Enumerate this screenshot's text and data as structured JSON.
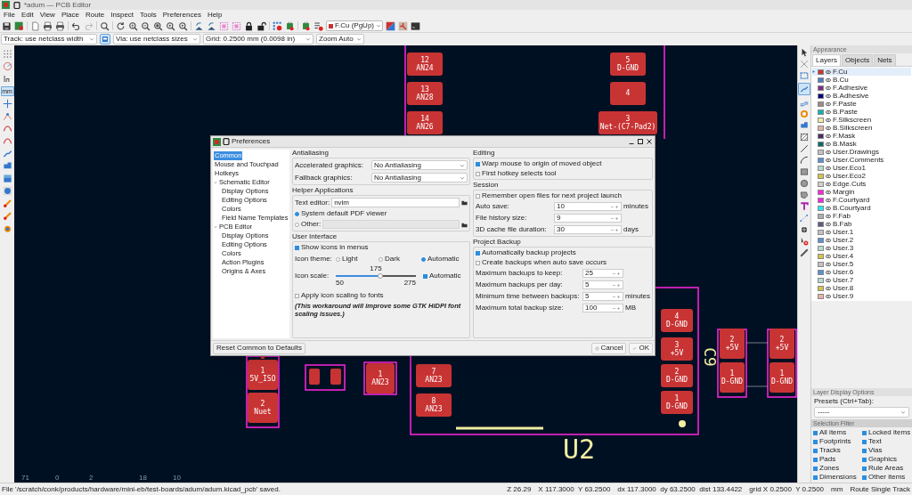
{
  "window": {
    "title": "*adum — PCB Editor"
  },
  "menu": [
    "File",
    "Edit",
    "View",
    "Place",
    "Route",
    "Inspect",
    "Tools",
    "Preferences",
    "Help"
  ],
  "toolbar": {
    "layer_select": "F.Cu (PgUp)"
  },
  "options_bar": {
    "track": "Track: use netclass width",
    "auto_width_on": true,
    "via": "Via: use netclass sizes",
    "grid": "Grid: 0.2500 mm (0.0098 in)",
    "zoom": "Zoom Auto"
  },
  "left_toolbar": {
    "units": "mm"
  },
  "canvas": {
    "pads": [
      {
        "number": "12",
        "net": "AN24"
      },
      {
        "number": "13",
        "net": "AN28"
      },
      {
        "number": "14",
        "net": "AN26"
      },
      {
        "number": "5",
        "net": "D-GND"
      },
      {
        "number": "4"
      },
      {
        "number": "3",
        "net": "Net-(C7-Pad2)"
      },
      {
        "number": "1",
        "net": "5V_ISO"
      },
      {
        "number": "2",
        "net": "Nuet"
      },
      {
        "number": "1",
        "net": "AN23"
      },
      {
        "number": "7",
        "net": "AN23"
      },
      {
        "number": "8",
        "net": "AN23"
      },
      {
        "number": "4",
        "net": "D-GND"
      },
      {
        "number": "3",
        "net": "+5V"
      },
      {
        "number": "2",
        "net": "D-GND"
      },
      {
        "number": "1",
        "net": "D-GND"
      },
      {
        "number": "2",
        "net": "+5V"
      },
      {
        "number": "1",
        "net": "D-GND"
      },
      {
        "number": "2",
        "net": "+5V"
      },
      {
        "number": "1",
        "net": "D-GND"
      }
    ],
    "silkscreen": [
      "U2",
      "C9"
    ],
    "ruler": [
      "71",
      "0",
      "2",
      "18",
      "10"
    ]
  },
  "dialog": {
    "title": "Preferences",
    "tree": [
      {
        "label": "Common",
        "selected": true
      },
      {
        "label": "Mouse and Touchpad",
        "selected": false
      },
      {
        "label": "Hotkeys",
        "selected": false
      },
      {
        "label": "Schematic Editor",
        "selected": false,
        "expanded": true,
        "children": [
          {
            "label": "Display Options",
            "selected": false
          },
          {
            "label": "Editing Options",
            "selected": false
          },
          {
            "label": "Colors",
            "selected": false
          },
          {
            "label": "Field Name Templates",
            "selected": false
          }
        ]
      },
      {
        "label": "PCB Editor",
        "selected": false,
        "expanded": true,
        "children": [
          {
            "label": "Display Options",
            "selected": false
          },
          {
            "label": "Editing Options",
            "selected": false
          },
          {
            "label": "Colors",
            "selected": false
          },
          {
            "label": "Action Plugins",
            "selected": false
          },
          {
            "label": "Origins & Axes",
            "selected": false
          }
        ]
      }
    ],
    "antialiasing": {
      "title": "Antialiasing",
      "rows": [
        {
          "label": "Accelerated graphics:",
          "value": "No Antialiasing"
        },
        {
          "label": "Fallback graphics:",
          "value": "No Antialiasing"
        }
      ]
    },
    "helpers": {
      "title": "Helper Applications",
      "text_editor_label": "Text editor:",
      "text_editor_value": "nvim",
      "pdf_options": [
        {
          "label": "System default PDF viewer",
          "selected": true
        },
        {
          "label": "Other:",
          "selected": false
        }
      ]
    },
    "user_interface": {
      "title": "User Interface",
      "show_icons": {
        "label": "Show icons in menus",
        "checked": true
      },
      "icon_theme_label": "Icon theme:",
      "icon_themes": [
        {
          "label": "Light",
          "selected": false
        },
        {
          "label": "Dark",
          "selected": false
        },
        {
          "label": "Automatic",
          "selected": true
        }
      ],
      "icon_scale_label": "Icon scale:",
      "icon_scale": {
        "reading": "175",
        "min": "50",
        "max": "275",
        "level": 0.56
      },
      "icon_scale_auto": {
        "label": "Automatic",
        "checked": true
      },
      "apply_scaling": {
        "label": "Apply icon scaling to fonts",
        "checked": false
      },
      "note": "(This workaround will improve some GTK HiDPI font scaling issues.)"
    },
    "editing": {
      "title": "Editing",
      "options": [
        {
          "label": "Warp mouse to origin of moved object",
          "checked": true
        },
        {
          "label": "First hotkey selects tool",
          "checked": false
        }
      ]
    },
    "session": {
      "title": "Session",
      "remember": {
        "label": "Remember open files for next project launch",
        "checked": false
      },
      "spins": [
        {
          "label": "Auto save:",
          "value": "10",
          "unit": "minutes"
        },
        {
          "label": "File history size:",
          "value": "9"
        },
        {
          "label": "3D cache file duration:",
          "value": "30",
          "unit": "days"
        }
      ]
    },
    "backup": {
      "title": "Project Backup",
      "options": [
        {
          "label": "Automatically backup projects",
          "checked": true
        },
        {
          "label": "Create backups when auto save occurs",
          "checked": false
        }
      ],
      "spins": [
        {
          "label": "Maximum backups to keep:",
          "value": "25"
        },
        {
          "label": "Maximum backups per day:",
          "value": "5"
        },
        {
          "label": "Minimum time between backups:",
          "value": "5",
          "unit": "minutes"
        },
        {
          "label": "Maximum total backup size:",
          "value": "100",
          "unit": "MB"
        }
      ]
    },
    "reset_button": "Reset Common to Defaults",
    "buttons": [
      "Cancel",
      "OK"
    ]
  },
  "appearance": {
    "title": "Appearance",
    "tabs": [
      {
        "label": "Layers",
        "selected": true
      },
      {
        "label": "Objects",
        "selected": false
      },
      {
        "label": "Nets",
        "selected": false
      }
    ],
    "layers": [
      {
        "name": "F.Cu",
        "color": "#c83434",
        "selected": true
      },
      {
        "name": "B.Cu",
        "color": "#4d7fc4",
        "selected": false
      },
      {
        "name": "F.Adhesive",
        "color": "#842c84",
        "selected": false
      },
      {
        "name": "B.Adhesive",
        "color": "#03007f",
        "selected": false
      },
      {
        "name": "F.Paste",
        "color": "#9c8c8a",
        "selected": false
      },
      {
        "name": "B.Paste",
        "color": "#11b3b3",
        "selected": false
      },
      {
        "name": "F.Silkscreen",
        "color": "#f2eda1",
        "selected": false
      },
      {
        "name": "B.Silkscreen",
        "color": "#e8b2a7",
        "selected": false
      },
      {
        "name": "F.Mask",
        "color": "#4d2a68",
        "selected": false
      },
      {
        "name": "B.Mask",
        "color": "#036b6b",
        "selected": false
      },
      {
        "name": "User.Drawings",
        "color": "#c2c2c2",
        "selected": false
      },
      {
        "name": "User.Comments",
        "color": "#5990d6",
        "selected": false
      },
      {
        "name": "User.Eco1",
        "color": "#b4dbd2",
        "selected": false
      },
      {
        "name": "User.Eco2",
        "color": "#d6c447",
        "selected": false
      },
      {
        "name": "Edge.Cuts",
        "color": "#d0d2cd",
        "selected": false
      },
      {
        "name": "Margin",
        "color": "#ff26e2",
        "selected": false
      },
      {
        "name": "F.Courtyard",
        "color": "#ff26e2",
        "selected": false
      },
      {
        "name": "B.Courtyard",
        "color": "#26e9ff",
        "selected": false
      },
      {
        "name": "F.Fab",
        "color": "#afafaf",
        "selected": false
      },
      {
        "name": "B.Fab",
        "color": "#585d84",
        "selected": false
      },
      {
        "name": "User.1",
        "color": "#c2c2c2",
        "selected": false
      },
      {
        "name": "User.2",
        "color": "#5990d6",
        "selected": false
      },
      {
        "name": "User.3",
        "color": "#b4dbd2",
        "selected": false
      },
      {
        "name": "User.4",
        "color": "#d6c447",
        "selected": false
      },
      {
        "name": "User.5",
        "color": "#c2c2c2",
        "selected": false
      },
      {
        "name": "User.6",
        "color": "#5990d6",
        "selected": false
      },
      {
        "name": "User.7",
        "color": "#b4dbd2",
        "selected": false
      },
      {
        "name": "User.8",
        "color": "#d6c447",
        "selected": false
      },
      {
        "name": "User.9",
        "color": "#e8b2a7",
        "selected": false
      }
    ],
    "display_options_title": "Layer Display Options",
    "presets_label": "Presets (Ctrl+Tab):",
    "presets_value": "-----",
    "filter_title": "Selection Filter",
    "filter": [
      {
        "label": "All items",
        "checked": true
      },
      {
        "label": "Locked items",
        "checked": true
      },
      {
        "label": "Footprints",
        "checked": true
      },
      {
        "label": "Text",
        "checked": true
      },
      {
        "label": "Tracks",
        "checked": true
      },
      {
        "label": "Vias",
        "checked": true
      },
      {
        "label": "Pads",
        "checked": true
      },
      {
        "label": "Graphics",
        "checked": true
      },
      {
        "label": "Zones",
        "checked": true
      },
      {
        "label": "Rule Areas",
        "checked": true
      },
      {
        "label": "Dimensions",
        "checked": true
      },
      {
        "label": "Other items",
        "checked": true
      }
    ]
  },
  "status_bar": {
    "message": "File '/scratch/conk/products/hardware/mini-eb/test-boards/adum/adum.kicad_pcb' saved.",
    "fields": [
      "Z 26.29",
      "X 117.3000  Y 63.2500",
      "dx 117.3000  dy 63.2500  dist 133.4422",
      "grid X 0.2500  Y 0.2500",
      "mm",
      "Route Single Track"
    ]
  }
}
